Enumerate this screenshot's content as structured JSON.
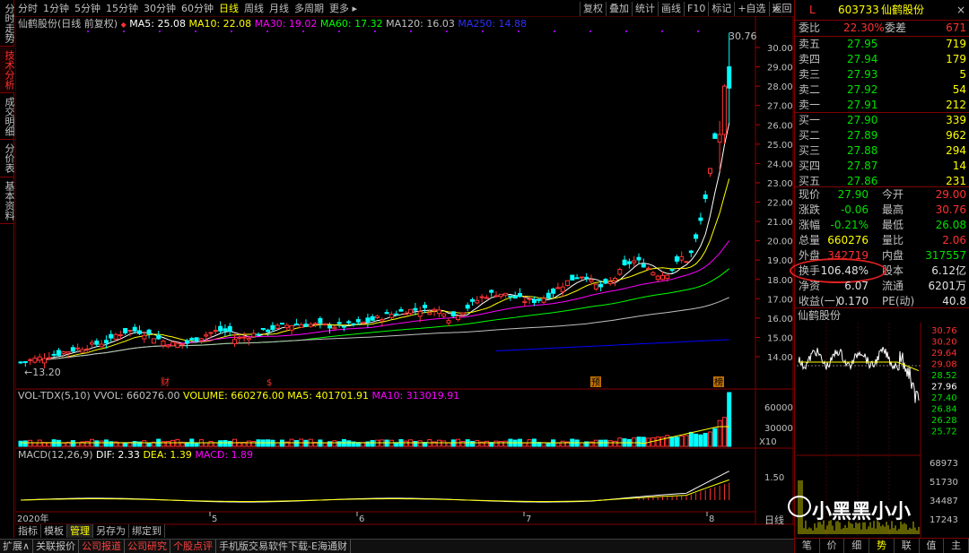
{
  "left_tabs": [
    "分时走势",
    "技术分析",
    "成交明细",
    "分价表",
    "基本资料"
  ],
  "period_bar": [
    "分时",
    "1分钟",
    "5分钟",
    "15分钟",
    "30分钟",
    "60分钟",
    "日线",
    "周线",
    "月线",
    "多周期",
    "更多"
  ],
  "selected_period": "日线",
  "top_buttons": [
    "复权",
    "叠加",
    "统计",
    "画线",
    "F10",
    "标记",
    "+自选",
    "返回"
  ],
  "close_label": "×",
  "legend_main": {
    "name": "仙鹤股份(日线 前复权)",
    "ma5": "MA5: 25.08",
    "ma10": "MA10: 22.08",
    "ma30": "MA30: 19.02",
    "ma60": "MA60: 17.32",
    "ma120": "MA120: 16.03",
    "ma250": "MA250: 14.88"
  },
  "legend_vol": {
    "name": "VOL-TDX(5,10)",
    "vvol": "VVOL: 660276.00",
    "volume": "VOLUME: 660276.00",
    "ma5": "MA5: 401701.91",
    "ma10": "MA10: 313019.91"
  },
  "legend_macd": {
    "name": "MACD(12,26,9)",
    "dif": "DIF: 2.33",
    "dea": "DEA: 1.39",
    "macd": "MACD: 1.89"
  },
  "price_axis": [
    "30.00",
    "29.00",
    "28.00",
    "27.00",
    "26.00",
    "25.00",
    "24.00",
    "23.00",
    "22.00",
    "21.00",
    "20.00",
    "19.00",
    "18.00",
    "17.00",
    "16.00",
    "15.00",
    "14.00"
  ],
  "vol_axis": [
    "60000",
    "30000",
    "X10"
  ],
  "macd_axis": [
    "1.50"
  ],
  "high_label": "30.76",
  "low_label": "13.20",
  "event_marks": [
    "财",
    "$",
    "预",
    "榜"
  ],
  "date_axis": [
    "2020年",
    "5",
    "6",
    "7",
    "8"
  ],
  "bottom_tabs1": [
    "指标",
    "模板",
    "管理",
    "另存为",
    "绑定到"
  ],
  "selected_bottom_tab": "管理",
  "bottom_tabs2": [
    "扩展∧",
    "关联报价",
    "公司报道",
    "公司研究",
    "个股点评",
    "手机版交易软件下载-E海通财"
  ],
  "stock": {
    "marker": "L",
    "code": "603733",
    "name": "仙鹤股份",
    "close_mark": "×"
  },
  "weibi": {
    "label": "委比",
    "value": "22.30%",
    "label2": "委差",
    "value2": "671"
  },
  "sell": [
    {
      "label": "卖五",
      "price": "27.95",
      "vol": "719"
    },
    {
      "label": "卖四",
      "price": "27.94",
      "vol": "179"
    },
    {
      "label": "卖三",
      "price": "27.93",
      "vol": "5"
    },
    {
      "label": "卖二",
      "price": "27.92",
      "vol": "54"
    },
    {
      "label": "卖一",
      "price": "27.91",
      "vol": "212"
    }
  ],
  "buy": [
    {
      "label": "买一",
      "price": "27.90",
      "vol": "339"
    },
    {
      "label": "买二",
      "price": "27.89",
      "vol": "962"
    },
    {
      "label": "买三",
      "price": "27.88",
      "vol": "294"
    },
    {
      "label": "买四",
      "price": "27.87",
      "vol": "14"
    },
    {
      "label": "买五",
      "price": "27.86",
      "vol": "231"
    }
  ],
  "quote": [
    {
      "l1": "现价",
      "v1": "27.90",
      "l2": "今开",
      "v2": "29.00"
    },
    {
      "l1": "涨跌",
      "v1": "-0.06",
      "l2": "最高",
      "v2": "30.76"
    },
    {
      "l1": "涨幅",
      "v1": "-0.21%",
      "l2": "最低",
      "v2": "26.08"
    },
    {
      "l1": "总量",
      "v1": "660276",
      "l2": "量比",
      "v2": "2.06"
    },
    {
      "l1": "外盘",
      "v1": "342719",
      "l2": "内盘",
      "v2": "317557"
    },
    {
      "l1": "换手",
      "v1": "106.48%",
      "l2": "股本",
      "v2": "6.12亿"
    },
    {
      "l1": "净资",
      "v1": "6.07",
      "l2": "流通",
      "v2": "6201万"
    },
    {
      "l1": "收益(一)",
      "v1": "0.170",
      "l2": "PE(动)",
      "v2": "40.8"
    }
  ],
  "mini_title": "仙鹤股份",
  "mini_axis": [
    "30.76",
    "30.20",
    "29.64",
    "29.08",
    "28.52",
    "27.96",
    "27.40",
    "26.84",
    "26.28",
    "25.72"
  ],
  "mini_vol_axis": [
    "68973",
    "51730",
    "34487",
    "17243"
  ],
  "rp_bottom_tabs": [
    "笔",
    "价",
    "细",
    "势",
    "联",
    "值",
    "主"
  ],
  "rp_bottom_selected": "势",
  "day_label": "日线",
  "watermark": "小黑黑小小",
  "colors": {
    "up": "#ff3232",
    "down": "#00ffff",
    "ma5": "#ffffff",
    "ma10": "#ffff00",
    "ma30": "#ff00ff",
    "ma60": "#00ff00",
    "ma120": "#c0c0c0",
    "ma250": "#0000ff"
  }
}
